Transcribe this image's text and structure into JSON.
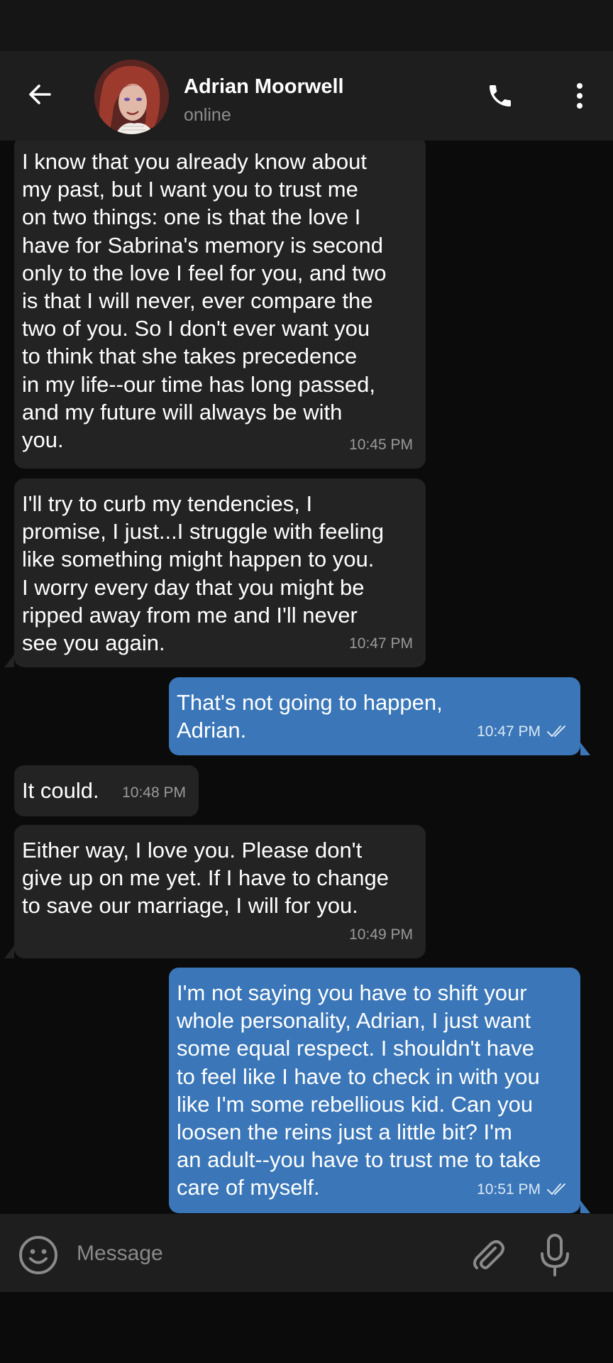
{
  "contact": {
    "name": "Adrian Moorwell",
    "status": "online"
  },
  "icons": {
    "back": "arrow-left-icon",
    "call": "phone-icon",
    "menu": "more-vertical-icon",
    "emoji": "smiley-icon",
    "attach": "paperclip-icon",
    "mic": "microphone-icon",
    "read": "double-check-icon"
  },
  "colors": {
    "incoming_bubble": "#232323",
    "outgoing_bubble": "#3a76b8",
    "header": "#1e1e1e",
    "background": "#0b0b0b"
  },
  "messages": [
    {
      "direction": "in",
      "text": "I know that you already know about\nmy past, but I want you to trust me\non two things: one is that the love I\nhave for Sabrina's memory is second\nonly to the love I feel for you, and two\nis that I will never, ever compare the\ntwo of you. So I don't ever want you\nto think that she takes precedence\nin my life--our time has long passed,\nand my future will always be with\nyou.",
      "time": "10:45 PM"
    },
    {
      "direction": "in",
      "text": "I'll try to curb my tendencies, I\npromise, I just...I struggle with feeling\nlike something might happen to you.\nI worry every day that you might be\nripped away from me and I'll never\nsee you again.",
      "time": "10:47 PM"
    },
    {
      "direction": "out",
      "text": "That's not going to happen,\nAdrian.",
      "time": "10:47 PM",
      "read": true
    },
    {
      "direction": "in",
      "text": "It could.",
      "time": "10:48 PM"
    },
    {
      "direction": "in",
      "text": "Either way, I love you. Please don't\ngive up on me yet. If I have to change\nto save our marriage, I will for you.",
      "time": "10:49 PM"
    },
    {
      "direction": "out",
      "text": "I'm not saying you have to shift your\nwhole personality, Adrian, I just want\nsome equal respect. I shouldn't have\nto feel like I have to check in with you\nlike I'm some rebellious kid. Can you\nloosen the reins just a little bit? I'm\nan adult--you have to trust me to take\ncare of myself.",
      "time": "10:51 PM",
      "read": true
    }
  ],
  "composer": {
    "placeholder": "Message"
  }
}
